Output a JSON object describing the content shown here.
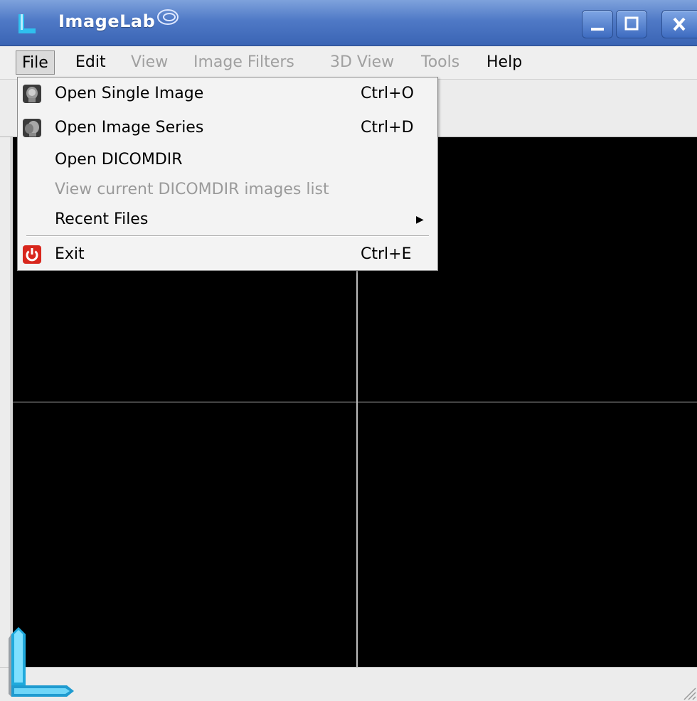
{
  "window": {
    "title": "ImageLab",
    "buttons": [
      "minimize",
      "maximize",
      "close"
    ]
  },
  "menubar": {
    "items": [
      {
        "label": "File",
        "enabled": true,
        "active": true
      },
      {
        "label": "Edit",
        "enabled": true
      },
      {
        "label": "View",
        "enabled": false
      },
      {
        "label": "Image Filters",
        "enabled": false
      },
      {
        "label": "3D View",
        "enabled": false
      },
      {
        "label": "Tools",
        "enabled": false
      },
      {
        "label": "Help",
        "enabled": true
      }
    ]
  },
  "file_menu": {
    "items": [
      {
        "label": "Open Single Image",
        "shortcut": "Ctrl+O",
        "icon": "head-scan-icon",
        "enabled": true
      },
      {
        "label": "Open Image Series",
        "shortcut": "Ctrl+D",
        "icon": "head-series-icon",
        "enabled": true
      },
      {
        "label": "Open DICOMDIR",
        "shortcut": "",
        "enabled": true
      },
      {
        "label": "View current DICOMDIR images list",
        "shortcut": "",
        "enabled": false
      },
      {
        "label": "Recent Files",
        "shortcut": "",
        "submenu": true,
        "enabled": true
      },
      {
        "label": "Exit",
        "shortcut": "Ctrl+E",
        "icon": "power-icon",
        "enabled": true
      }
    ]
  },
  "colors": {
    "titlebar": "#4f79c6",
    "viewer_bg": "#000000",
    "logo_cyan": "#27b7e6",
    "exit_red": "#d8261c"
  }
}
